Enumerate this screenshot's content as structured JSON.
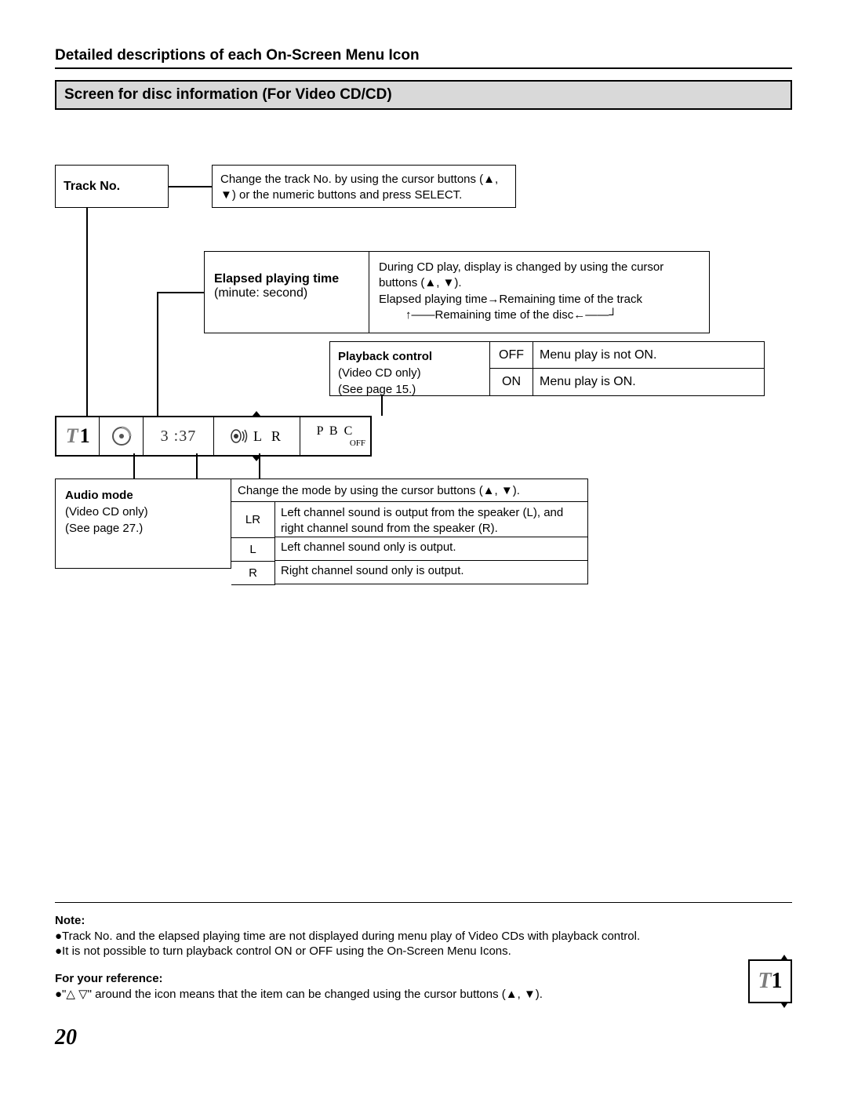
{
  "header": "Detailed descriptions of each On-Screen Menu Icon",
  "section_title": "Screen for disc information (For Video CD/CD)",
  "track": {
    "label": "Track No.",
    "desc": "Change the track No. by using the cursor buttons (▲, ▼) or the numeric buttons and press SELECT."
  },
  "elapsed": {
    "label_bold": "Elapsed playing time",
    "label_sub": "(minute: second)",
    "desc1": "During CD play, display is changed by using the cursor buttons (▲, ▼).",
    "desc2": "Elapsed playing time→Remaining time of the track",
    "desc3_prefix": "↑——",
    "desc3_mid": "Remaining time of the disc",
    "desc3_suffix": "←——┘"
  },
  "pbc": {
    "label_bold": "Playback control",
    "label_sub1": "(Video CD only)",
    "label_sub2": "(See page 15.)",
    "rows": [
      {
        "key": "OFF",
        "desc": "Menu play is not ON."
      },
      {
        "key": "ON",
        "desc": "Menu play is ON."
      }
    ]
  },
  "osd": {
    "track_letter": "T",
    "track_number": "1",
    "time": "3 :37",
    "audio_lr": "L   R",
    "pbc_label": "P B C",
    "pbc_state": "OFF"
  },
  "audio": {
    "label_bold": "Audio mode",
    "label_sub1": "(Video CD only)",
    "label_sub2": "(See page 27.)",
    "head": "Change the mode by using the cursor buttons (▲, ▼).",
    "rows": [
      {
        "key": "LR",
        "desc": "Left channel sound is output from the speaker (L), and right channel sound from the speaker (R)."
      },
      {
        "key": "L",
        "desc": "Left channel sound only is output."
      },
      {
        "key": "R",
        "desc": "Right channel sound only is output."
      }
    ]
  },
  "notes": {
    "head": "Note:",
    "n1": "●Track No. and the elapsed playing time are not displayed during menu play of Video CDs with playback control.",
    "n2": "●It is not possible to turn playback control ON or OFF using the On-Screen Menu Icons."
  },
  "reference": {
    "head": "For your reference:",
    "text": "●\"△ ▽\" around the icon means that the item can be changed using the cursor buttons (▲, ▼).",
    "icon_letter": "T",
    "icon_number": "1"
  },
  "page_number": "20"
}
